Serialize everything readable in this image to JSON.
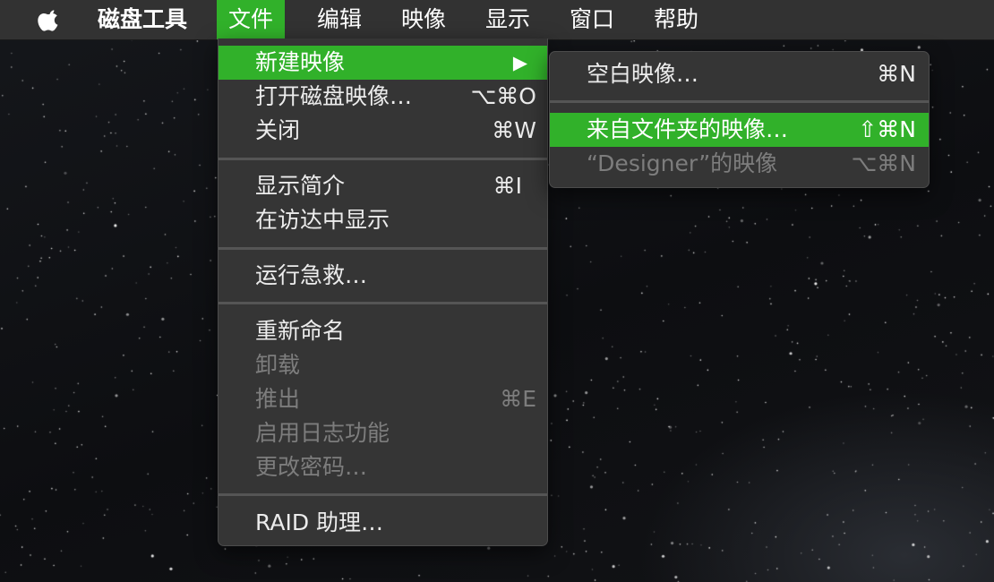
{
  "menubar": {
    "apple_icon": "apple-logo-icon",
    "app_name": "磁盘工具",
    "items": [
      "文件",
      "编辑",
      "映像",
      "显示",
      "窗口",
      "帮助"
    ],
    "active_item": "文件"
  },
  "file_menu": {
    "new_image": {
      "label": "新建映像",
      "arrow": "▶"
    },
    "open_disk_image": {
      "label": "打开磁盘映像…",
      "shortcut": "⌥⌘O"
    },
    "close": {
      "label": "关闭",
      "shortcut": "⌘W"
    },
    "get_info": {
      "label": "显示简介",
      "shortcut": "⌘I"
    },
    "show_in_finder": {
      "label": "在访达中显示"
    },
    "first_aid": {
      "label": "运行急救…"
    },
    "rename": {
      "label": "重新命名"
    },
    "unmount": {
      "label": "卸载"
    },
    "eject": {
      "label": "推出",
      "shortcut": "⌘E"
    },
    "enable_journaling": {
      "label": "启用日志功能"
    },
    "change_password": {
      "label": "更改密码…"
    },
    "raid_assistant": {
      "label": "RAID 助理…"
    }
  },
  "new_image_submenu": {
    "blank_image": {
      "label": "空白映像…",
      "shortcut": "⌘N"
    },
    "image_from_folder": {
      "label": "来自文件夹的映像…",
      "shortcut": "⇧⌘N"
    },
    "image_from_designer": {
      "label": "“Designer”的映像",
      "shortcut": "⌥⌘N"
    }
  },
  "colors": {
    "highlight": "#31b12a",
    "menu_bg": "#353535",
    "menubar_bg": "#323232",
    "disabled_text": "#7d7d7d"
  }
}
